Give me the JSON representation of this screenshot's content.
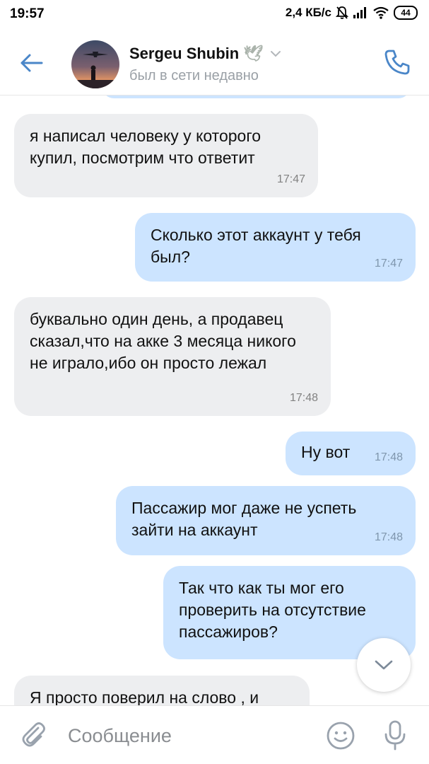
{
  "status_bar": {
    "time": "19:57",
    "speed": "2,4 КБ/с",
    "battery": "44",
    "icons": [
      "alarm-off-icon",
      "signal-icon",
      "wifi-icon",
      "battery-icon"
    ]
  },
  "header": {
    "contact_name": "Sergeu Shubin",
    "name_emoji": "🕊",
    "status": "был в сети недавно",
    "accent_color": "#4a86c8",
    "icons": [
      "back-arrow-icon",
      "avatar",
      "chevron-down-icon",
      "phone-icon"
    ]
  },
  "messages": [
    {
      "direction": "in",
      "text": "я написал человеку у которого купил, посмотрим что ответит",
      "time": "17:47"
    },
    {
      "direction": "out",
      "text": "Сколько этот аккаунт у тебя был?",
      "time": "17:47"
    },
    {
      "direction": "in",
      "text": "буквально один день, а продавец сказал,что на акке 3 месяца никого не играло,ибо он просто лежал",
      "time": "17:48"
    },
    {
      "direction": "out",
      "text": "Ну вот",
      "time": "17:48"
    },
    {
      "direction": "out",
      "text": "Пассажир мог даже не успеть зайти на аккаунт",
      "time": "17:48"
    },
    {
      "direction": "out",
      "text": "Так что как ты мог его проверить на отсутствие пассажиров?",
      "time": ""
    },
    {
      "direction": "in",
      "text": "Я просто поверил на слово , и",
      "time": ""
    }
  ],
  "composer": {
    "placeholder": "Сообщение",
    "value": "",
    "icons": [
      "attach-icon",
      "emoji-icon",
      "microphone-icon"
    ]
  },
  "colors": {
    "incoming_bubble": "#edeef0",
    "outgoing_bubble": "#cce4ff",
    "timestamp": "#828282"
  }
}
